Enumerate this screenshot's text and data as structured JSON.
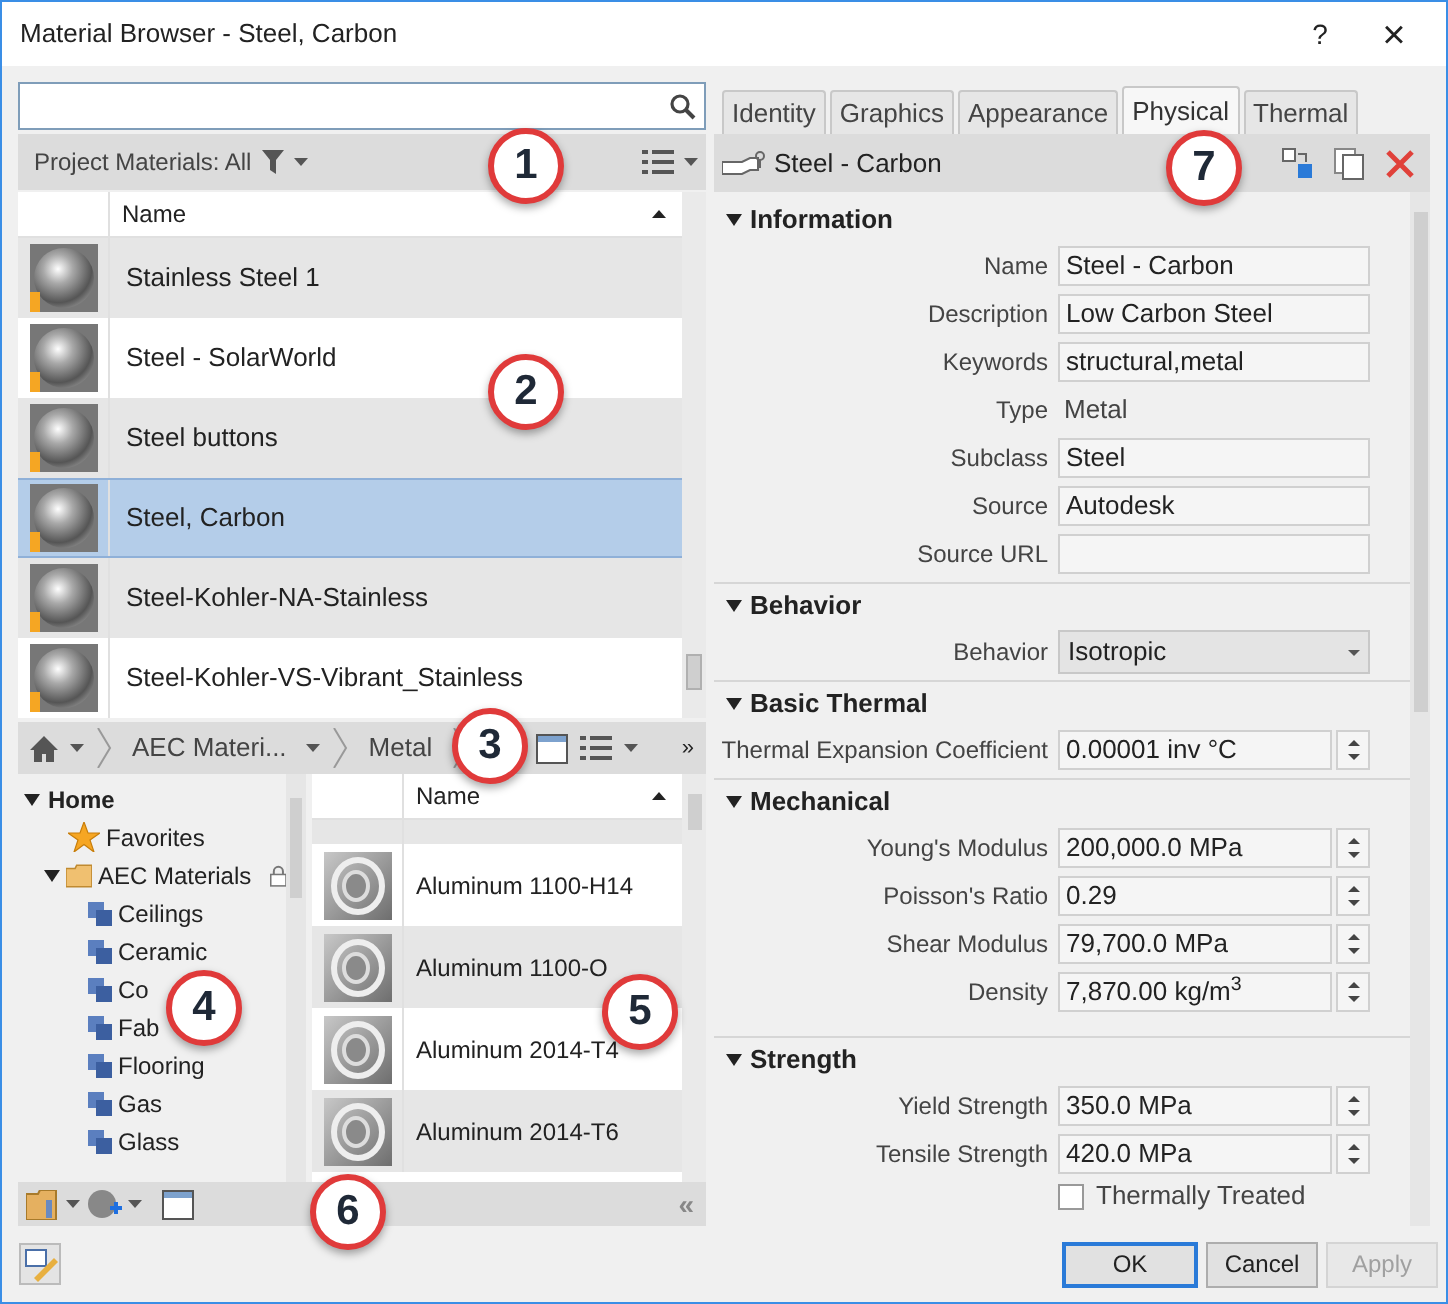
{
  "window": {
    "title": "Material Browser - Steel, Carbon",
    "help": "?",
    "close": "×"
  },
  "library_bar": {
    "label": "Project Materials: All"
  },
  "project_materials": {
    "column": "Name",
    "rows": [
      {
        "name": "Stainless Steel 1",
        "selected": false
      },
      {
        "name": "Steel - SolarWorld",
        "selected": false
      },
      {
        "name": "Steel buttons",
        "selected": false
      },
      {
        "name": "Steel, Carbon",
        "selected": true
      },
      {
        "name": "Steel-Kohler-NA-Stainless",
        "selected": false
      },
      {
        "name": "Steel-Kohler-VS-Vibrant_Stainless",
        "selected": false
      }
    ]
  },
  "breadcrumb": {
    "items": [
      "AEC Materi...",
      "Metal"
    ],
    "more": "»"
  },
  "tree": [
    {
      "label": "Home",
      "kind": "root",
      "expanded": true,
      "children": [
        {
          "label": "Favorites",
          "kind": "favorites"
        },
        {
          "label": "AEC Materials",
          "kind": "library",
          "expanded": true,
          "locked": true,
          "children": [
            {
              "label": "Ceilings",
              "kind": "category"
            },
            {
              "label": "Ceramic",
              "kind": "category"
            },
            {
              "label": "Co",
              "kind": "category"
            },
            {
              "label": "Fab",
              "kind": "category"
            },
            {
              "label": "Flooring",
              "kind": "category"
            },
            {
              "label": "Gas",
              "kind": "category"
            },
            {
              "label": "Glass",
              "kind": "category"
            }
          ]
        }
      ]
    }
  ],
  "library_materials": {
    "column": "Name",
    "rows": [
      {
        "name": "Aluminum 1100-H14"
      },
      {
        "name": "Aluminum 1100-O"
      },
      {
        "name": "Aluminum 2014-T4"
      },
      {
        "name": "Aluminum 2014-T6"
      }
    ]
  },
  "bottom_toolbar": {
    "collapse": "«"
  },
  "tabs": [
    {
      "label": "Identity",
      "selected": false
    },
    {
      "label": "Graphics",
      "selected": false
    },
    {
      "label": "Appearance",
      "selected": false
    },
    {
      "label": "Physical",
      "selected": true
    },
    {
      "label": "Thermal",
      "selected": false
    }
  ],
  "asset": {
    "name": "Steel - Carbon"
  },
  "sections": [
    {
      "title": "Information",
      "expanded": true,
      "properties": [
        {
          "kind": "text",
          "label": "Name",
          "value": "Steel - Carbon"
        },
        {
          "kind": "text",
          "label": "Description",
          "value": "Low Carbon Steel"
        },
        {
          "kind": "text",
          "label": "Keywords",
          "value": "structural,metal"
        },
        {
          "kind": "readonly",
          "label": "Type",
          "value": "Metal"
        },
        {
          "kind": "text",
          "label": "Subclass",
          "value": "Steel"
        },
        {
          "kind": "text",
          "label": "Source",
          "value": "Autodesk"
        },
        {
          "kind": "text",
          "label": "Source URL"
        }
      ]
    },
    {
      "title": "Behavior",
      "expanded": true,
      "properties": [
        {
          "kind": "dropdown",
          "label": "Behavior",
          "value": "Isotropic"
        }
      ]
    },
    {
      "title": "Basic Thermal",
      "expanded": true,
      "properties": [
        {
          "kind": "spinner",
          "label": "Thermal Expansion Coefficient",
          "value": "0.00001 inv °C"
        }
      ]
    },
    {
      "title": "Mechanical",
      "expanded": true,
      "properties": [
        {
          "kind": "spinner",
          "label": "Young's Modulus",
          "value": "200,000.0 MPa"
        },
        {
          "kind": "spinner",
          "label": "Poisson's Ratio",
          "value": "0.29"
        },
        {
          "kind": "spinner",
          "label": "Shear Modulus",
          "value": "79,700.0 MPa"
        },
        {
          "kind": "spinner",
          "label": "Density",
          "value": "7,870.00 kg/m$^{3}$"
        }
      ]
    },
    {
      "title": "Strength",
      "expanded": true,
      "properties": [
        {
          "kind": "spinner",
          "label": "Yield Strength",
          "value": "350.0 MPa"
        },
        {
          "kind": "spinner",
          "label": "Tensile Strength",
          "value": "420.0 MPa"
        },
        {
          "kind": "checkbox",
          "label": "Thermally Treated",
          "checked": false
        }
      ]
    }
  ],
  "buttons": [
    {
      "label": "OK",
      "default": true,
      "disabled": false
    },
    {
      "label": "Cancel",
      "default": false,
      "disabled": false
    },
    {
      "label": "Apply",
      "default": false,
      "disabled": true
    }
  ],
  "callouts": [
    "1",
    "2",
    "3",
    "4",
    "5",
    "6",
    "7"
  ]
}
